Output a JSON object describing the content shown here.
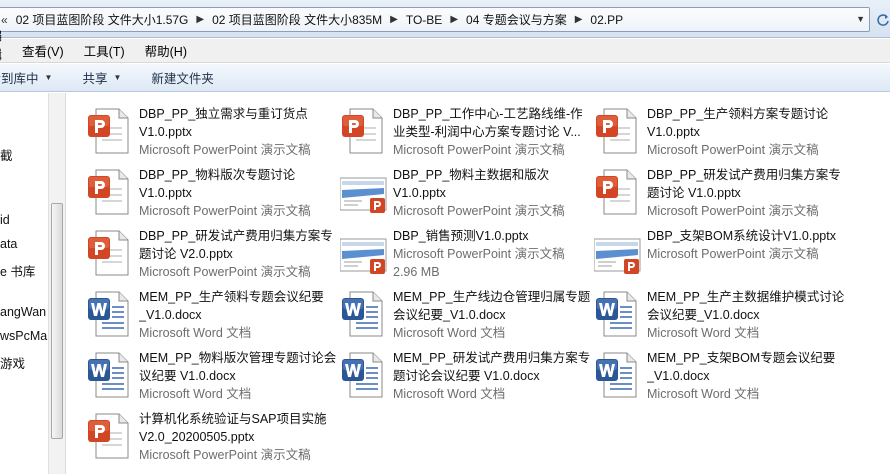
{
  "breadcrumb": {
    "first_sep": "«",
    "items": [
      "02 项目蓝图阶段 文件大小1.57G",
      "02 项目蓝图阶段 文件大小835M",
      "TO-BE",
      "04 专题会议与方案",
      "02.PP"
    ]
  },
  "menu": [
    "编辑(E)",
    "查看(V)",
    "工具(T)",
    "帮助(H)"
  ],
  "toolbar": {
    "include": "包含到库中",
    "share": "共享",
    "new_folder": "新建文件夹"
  },
  "nav": [
    "截",
    "id",
    "ata",
    "e 书库",
    "angWan",
    "wsPcMa",
    "游戏"
  ],
  "files": [
    {
      "name": "DBP_PP_独立需求与重订货点V1.0.pptx",
      "type": "Microsoft PowerPoint 演示文稿",
      "kind": "ppt"
    },
    {
      "name": "DBP_PP_工作中心-工艺路线维-作业类型-利润中心方案专题讨论 V...",
      "type": "Microsoft PowerPoint 演示文稿",
      "kind": "ppt"
    },
    {
      "name": "DBP_PP_生产领料方案专题讨论V1.0.pptx",
      "type": "Microsoft PowerPoint 演示文稿",
      "kind": "ppt"
    },
    {
      "name": "DBP_PP_物料版次专题讨论V1.0.pptx",
      "type": "Microsoft PowerPoint 演示文稿",
      "kind": "ppt"
    },
    {
      "name": "DBP_PP_物料主数据和版次V1.0.pptx",
      "type": "Microsoft PowerPoint 演示文稿",
      "kind": "pptthumb"
    },
    {
      "name": "DBP_PP_研发试产费用归集方案专题讨论 V1.0.pptx",
      "type": "Microsoft PowerPoint 演示文稿",
      "kind": "ppt"
    },
    {
      "name": "DBP_PP_研发试产费用归集方案专题讨论 V2.0.pptx",
      "type": "Microsoft PowerPoint 演示文稿",
      "kind": "ppt"
    },
    {
      "name": "DBP_销售预测V1.0.pptx",
      "type": "Microsoft PowerPoint 演示文稿",
      "size": "2.96 MB",
      "kind": "pptthumb"
    },
    {
      "name": "DBP_支架BOM系统设计V1.0.pptx",
      "type": "Microsoft PowerPoint 演示文稿",
      "kind": "pptthumb"
    },
    {
      "name": "MEM_PP_生产领料专题会议纪要_V1.0.docx",
      "type": "Microsoft Word 文档",
      "kind": "word"
    },
    {
      "name": "MEM_PP_生产线边仓管理归属专题会议纪要_V1.0.docx",
      "type": "Microsoft Word 文档",
      "kind": "word"
    },
    {
      "name": "MEM_PP_生产主数据维护模式讨论会议纪要_V1.0.docx",
      "type": "Microsoft Word 文档",
      "kind": "word"
    },
    {
      "name": "MEM_PP_物料版次管理专题讨论会议纪要 V1.0.docx",
      "type": "Microsoft Word 文档",
      "kind": "word"
    },
    {
      "name": "MEM_PP_研发试产费用归集方案专题讨论会议纪要 V1.0.docx",
      "type": "Microsoft Word 文档",
      "kind": "word"
    },
    {
      "name": "MEM_PP_支架BOM专题会议纪要_V1.0.docx",
      "type": "Microsoft Word 文档",
      "kind": "word"
    },
    {
      "name": "计算机化系统验证与SAP项目实施V2.0_20200505.pptx",
      "type": "Microsoft PowerPoint 演示文稿",
      "kind": "ppt"
    }
  ],
  "colors": {
    "ppt": "#d24625",
    "word": "#2b5797",
    "toolbar_text": "#1e2f47",
    "type_text": "#6d6d6d"
  }
}
